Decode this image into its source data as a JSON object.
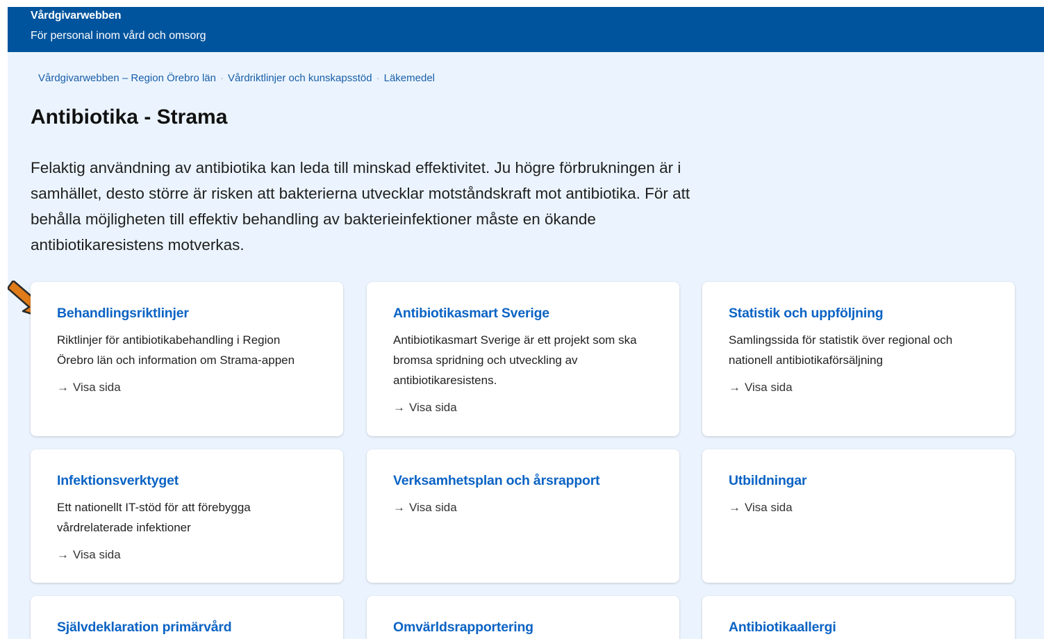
{
  "header": {
    "site_title": "Vårdgivarwebben",
    "site_subtitle": "För personal inom vård och omsorg"
  },
  "breadcrumb": [
    "Vårdgivarwebben – Region Örebro län",
    "Vårdriktlinjer och kunskapsstöd",
    "Läkemedel"
  ],
  "page": {
    "title": "Antibiotika - Strama",
    "intro": "Felaktig användning av antibiotika kan leda till minskad effektivitet. Ju högre förbrukningen är i samhället, desto större är risken att bakterierna utvecklar motståndskraft mot antibiotika. För att behålla möjligheten till effektiv behandling av bakterieinfektioner måste en ökande antibiotikaresistens motverkas."
  },
  "cards": [
    {
      "title": "Behandlingsriktlinjer",
      "text": "Riktlinjer för antibiotikabehandling i Region Örebro län och information om Strama-appen",
      "link": "Visa sida"
    },
    {
      "title": "Antibiotikasmart Sverige",
      "text": "Antibiotikasmart Sverige är ett projekt som ska bromsa spridning och utveckling av antibiotikaresistens.",
      "link": "Visa sida"
    },
    {
      "title": "Statistik och uppföljning",
      "text": "Samlingssida för statistik över regional och nationell antibiotikaförsäljning",
      "link": "Visa sida"
    },
    {
      "title": "Infektionsverktyget",
      "text": "Ett nationellt IT-stöd för att förebygga vårdrelaterade infektioner",
      "link": "Visa sida"
    },
    {
      "title": "Verksamhetsplan och årsrapport",
      "text": "",
      "link": "Visa sida"
    },
    {
      "title": "Utbildningar",
      "text": "",
      "link": "Visa sida"
    },
    {
      "title": "Självdeklaration primärvård",
      "text": "",
      "link": ""
    },
    {
      "title": "Omvärldsrapportering",
      "text": "",
      "link": ""
    },
    {
      "title": "Antibiotikaallergi",
      "text": "",
      "link": ""
    }
  ],
  "link_arrow": "→",
  "colors": {
    "header_bg": "#00549d",
    "page_bg": "#ebf4fe",
    "card_title": "#0b63c4",
    "pointer_arrow": "#e07b1a"
  }
}
